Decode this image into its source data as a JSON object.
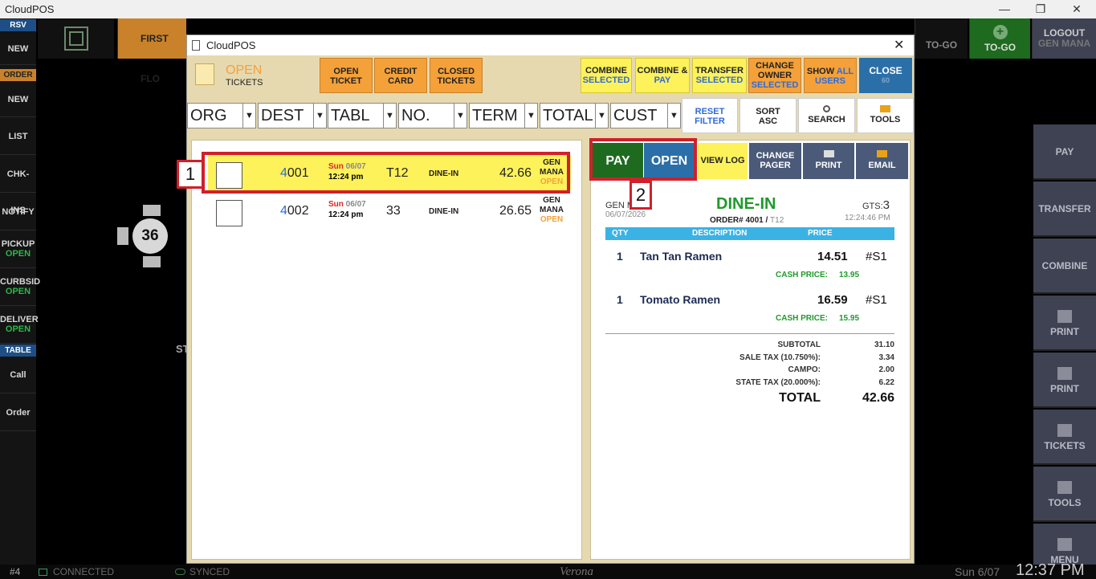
{
  "window": {
    "title": "CloudPOS",
    "ctl_min": "—",
    "ctl_max": "❐",
    "ctl_close": "✕"
  },
  "left_sidebar": {
    "rsv": "RSV",
    "rsv_new": "NEW",
    "order": "ORDER",
    "order_new": "NEW",
    "list": "LIST",
    "chkins": "CHK-INS",
    "notify": "NOTIFY",
    "pickup": "PICKUP",
    "pickup_status": "OPEN",
    "curbside": "CURBSID",
    "curbside_status": "OPEN",
    "delivery": "DELIVER",
    "delivery_status": "OPEN",
    "table": "TABLE",
    "call": "Call",
    "order_btn": "Order"
  },
  "top_bar": {
    "floor": "FIRST FLO",
    "togo_dim": "TO-GO",
    "togo_plus": "+",
    "togo": "TO-GO",
    "logout": "LOGOUT",
    "logout_user": "GEN MANA"
  },
  "right_sidebar": [
    "PAY",
    "TRANSFER",
    "COMBINE",
    "PRINT",
    "PRINT",
    "TICKETS",
    "TOOLS",
    "MENU"
  ],
  "floor": {
    "table_number": "36",
    "partial_label": "ST"
  },
  "status_bar": {
    "station": "#4",
    "connected": "CONNECTED",
    "synced": "SYNCED",
    "brand": "Verona",
    "date": "Sun 6/07",
    "time": "12:37 PM"
  },
  "dialog": {
    "title": "CloudPOS",
    "close_x": "✕",
    "header": {
      "status": "OPEN",
      "sub": "TICKETS"
    },
    "buttons": {
      "open_ticket": [
        "OPEN",
        "TICKET"
      ],
      "credit_card": [
        "CREDIT",
        "CARD"
      ],
      "closed_tickets": [
        "CLOSED",
        "TICKETS"
      ],
      "combine_selected": [
        "COMBINE",
        "SELECTED"
      ],
      "combine_pay": [
        "COMBINE &",
        "PAY"
      ],
      "transfer_selected": [
        "TRANSFER",
        "SELECTED"
      ],
      "change_owner": [
        "CHANGE",
        "OWNER",
        "SELECTED"
      ],
      "show_all_users": [
        "SHOW",
        "ALL",
        "USERS"
      ],
      "close": [
        "CLOSE",
        "60"
      ]
    },
    "filters": [
      "ORG",
      "DEST",
      "TABL",
      "NO.",
      "TERM",
      "TOTAL",
      "CUST"
    ],
    "filter_dd": "▼",
    "tools": {
      "reset": [
        "RESET",
        "FILTER"
      ],
      "sort": [
        "SORT",
        "ASC"
      ],
      "search": "SEARCH",
      "tools": "TOOLS"
    },
    "tickets": [
      {
        "num_first": "4",
        "num_rest": "001",
        "day": "Sun",
        "date": "06/07",
        "time": "12:24 pm",
        "table": "T12",
        "dest": "DINE-IN",
        "total": "42.66",
        "owner1": "GEN",
        "owner2": "MANA",
        "status": "OPEN",
        "selected": true
      },
      {
        "num_first": "4",
        "num_rest": "002",
        "day": "Sun",
        "date": "06/07",
        "time": "12:24 pm",
        "table": "33",
        "dest": "DINE-IN",
        "total": "26.65",
        "owner1": "GEN",
        "owner2": "MANA",
        "status": "OPEN",
        "selected": false
      }
    ],
    "actions": {
      "pay": "PAY",
      "open": "OPEN",
      "view_log": "VIEW LOG",
      "change_pager": [
        "CHANGE",
        "PAGER"
      ],
      "print": "PRINT",
      "email": "EMAIL"
    },
    "detail": {
      "owner_partial": "GEN M",
      "date": "06/07/2026",
      "dest": "DINE-IN",
      "order_prefix": "ORDER# 4001 / ",
      "order_table": "T12",
      "guests_label": "GTS:",
      "guests": "3",
      "time": "12:24:46 PM",
      "col_qty": "QTY",
      "col_desc": "DESCRIPTION",
      "col_price": "PRICE",
      "items": [
        {
          "qty": "1",
          "name": "Tan Tan Ramen",
          "price": "14.51",
          "seat": "#S1",
          "cash_label": "CASH PRICE:",
          "cash": "13.95"
        },
        {
          "qty": "1",
          "name": "Tomato Ramen",
          "price": "16.59",
          "seat": "#S1",
          "cash_label": "CASH PRICE:",
          "cash": "15.95"
        }
      ],
      "totals": [
        {
          "label": "SUBTOTAL",
          "value": "31.10"
        },
        {
          "label": "SALE TAX (10.750%):",
          "value": "3.34"
        },
        {
          "label": "CAMPO:",
          "value": "2.00"
        },
        {
          "label": "STATE TAX (20.000%):",
          "value": "6.22"
        }
      ],
      "total_label": "TOTAL",
      "total_value": "42.66"
    }
  },
  "annotations": {
    "tag1": "1",
    "tag2": "2"
  },
  "colors": {
    "accent_orange": "#f4a13a",
    "accent_yellow": "#fdf25a",
    "pay_green": "#1e6a1e",
    "open_blue": "#2b6fa8",
    "highlight_red": "#d0202a",
    "dine_in_green": "#1f9a2a"
  }
}
